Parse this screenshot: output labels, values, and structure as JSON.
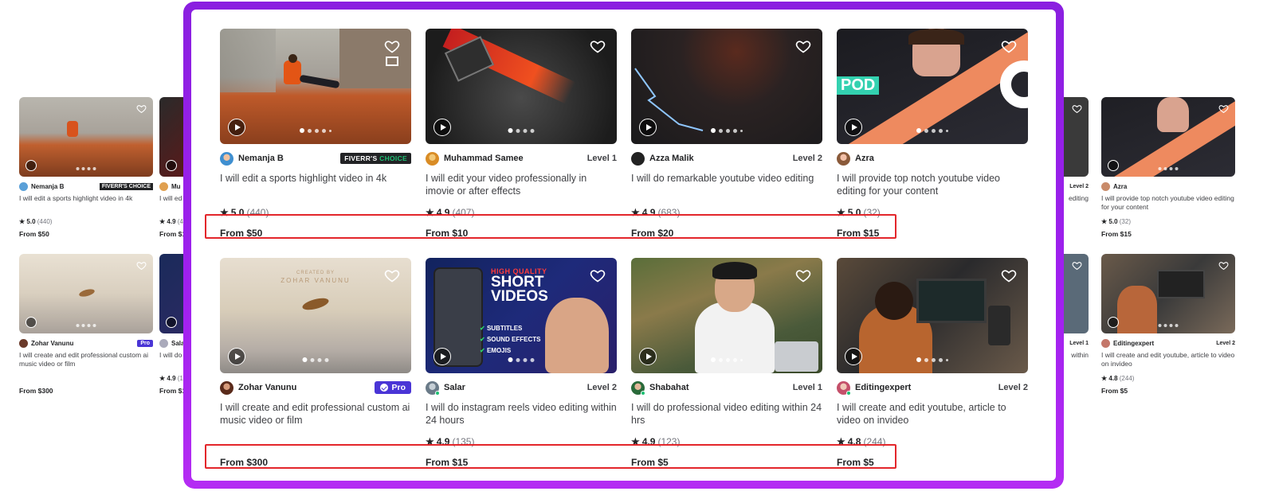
{
  "colors": {
    "frame_gradient_start": "#8a1fe0",
    "frame_gradient_end": "#b42cf3",
    "highlight": "#e3262b",
    "pro_badge": "#4a35d6",
    "choice_badge": "#222325",
    "online": "#1dbf73"
  },
  "icons": {
    "favorite": "heart-icon",
    "video": "play-icon",
    "rating": "star-icon",
    "verified": "check-icon"
  },
  "gigs": [
    {
      "seller": "Nemanja B",
      "badge": "FIVERR'S CHOICE",
      "badge_a": "FIVERR'S",
      "badge_b": "CHOICE",
      "title": "I will edit a sports highlight video in 4k",
      "rating": "5.0",
      "reviews": "(440)",
      "price": "From $50"
    },
    {
      "seller": "Muhammad Samee",
      "badge": "Level 1",
      "title": "I will edit your video professionally in imovie or after effects",
      "rating": "4.9",
      "reviews": "(407)",
      "price": "From $10"
    },
    {
      "seller": "Azza Malik",
      "badge": "Level 2",
      "title": "I will do remarkable youtube video editing",
      "rating": "4.9",
      "reviews": "(683)",
      "price": "From $20"
    },
    {
      "seller": "Azra",
      "badge": "",
      "title": "I will provide top notch youtube video editing for your content",
      "rating": "5.0",
      "reviews": "(32)",
      "price": "From $15"
    },
    {
      "seller": "Zohar Vanunu",
      "badge": "Pro",
      "title": "I will create and edit professional custom ai music video or film",
      "rating": "",
      "reviews": "",
      "price": "From $300"
    },
    {
      "seller": "Salar",
      "badge": "Level 2",
      "title": "I will do instagram reels video editing within 24 hours",
      "rating": "4.9",
      "reviews": "(135)",
      "price": "From $15"
    },
    {
      "seller": "Shabahat",
      "badge": "Level 1",
      "title": "I will do professional video editing within 24 hrs",
      "rating": "4.9",
      "reviews": "(123)",
      "price": "From $5"
    },
    {
      "seller": "Editingexpert",
      "badge": "Level 2",
      "title": "I will create and edit youtube, article to video on invideo",
      "rating": "4.8",
      "reviews": "(244)",
      "price": "From $5"
    }
  ],
  "thumb_text": {
    "zohar_credit": "CREATED BY",
    "zohar_name": "ZOHAR VANUNU",
    "salar_hq": "HIGH QUALITY",
    "salar_short": "SHORT",
    "salar_videos": "VIDEOS",
    "salar_f1": "SUBTITLES",
    "salar_f2": "SOUND EFFECTS",
    "salar_f3": "EMOJIS",
    "azra_pod": "POD"
  },
  "bg_left": {
    "row1": {
      "seller": "Nemanja B",
      "badge": "FIVERR'S CHOICE",
      "title": "I will edit a sports highlight video in 4k",
      "rating": "5.0",
      "reviews": "(440)",
      "price": "From $50"
    },
    "row1_partial": {
      "seller": "Mu",
      "title": "I will ed imovie o",
      "rating": "4.9",
      "reviews": "(4",
      "price": "From $1"
    },
    "row2": {
      "seller": "Zohar Vanunu",
      "badge": "Pro",
      "title": "I will create and edit professional custom ai music video or film",
      "price": "From $300"
    },
    "row2_partial": {
      "seller": "Sala",
      "title": "I will do within 2",
      "rating": "4.9",
      "reviews": "(1",
      "price": "From $1"
    }
  },
  "bg_right": {
    "row1_partial": {
      "badge": "Level 2",
      "title": "editing"
    },
    "row1": {
      "seller": "Azra",
      "title": "I will provide top notch youtube video editing for your content",
      "rating": "5.0",
      "reviews": "(32)",
      "price": "From $15"
    },
    "row2_partial": {
      "badge": "Level 1",
      "title": "within"
    },
    "row2": {
      "seller": "Editingexpert",
      "badge": "Level 2",
      "title": "I will create and edit youtube, article to video on invideo",
      "rating": "4.8",
      "reviews": "(244)",
      "price": "From $5"
    }
  }
}
